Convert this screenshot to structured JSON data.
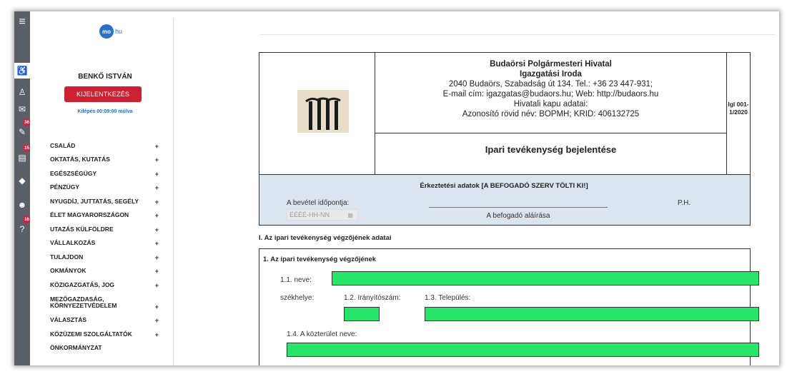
{
  "rail": {
    "icons": [
      {
        "name": "menu-icon",
        "glyph": "≡"
      },
      {
        "name": "accessibility-icon",
        "glyph": "♿"
      },
      {
        "name": "user-icon",
        "glyph": "♙"
      },
      {
        "name": "mail-icon",
        "glyph": "✉"
      },
      {
        "name": "tools-icon",
        "glyph": "✎",
        "badge": "36"
      },
      {
        "name": "card-icon",
        "glyph": "▤",
        "badge": "15"
      },
      {
        "name": "shield-icon",
        "glyph": "◆"
      },
      {
        "name": "people-icon",
        "glyph": "☻"
      },
      {
        "name": "help-icon",
        "glyph": "?",
        "badge": "16"
      }
    ]
  },
  "sidebar": {
    "logo_text": "mo",
    "logo_suffix": "hu",
    "user_name": "BENKŐ ISTVÁN",
    "logout_label": "KIJELENTKEZÉS",
    "timer": "Kilépés 00:09:00 múlva",
    "menu": [
      "CSALÁD",
      "OKTATÁS, KUTATÁS",
      "EGÉSZSÉGÜGY",
      "PÉNZÜGY",
      "NYUGDÍJ, JUTTATÁS, SEGÉLY",
      "ÉLET MAGYARORSZÁGON",
      "UTAZÁS KÜLFÖLDRE",
      "VÁLLALKOZÁS",
      "TULAJDON",
      "OKMÁNYOK",
      "KÖZIGAZGATÁS, JOG",
      "MEZŐGAZDASÁG, KÖRNYEZETVÉDELEM",
      "VÁLASZTÁS",
      "KÖZÜZEMI SZOLGÁLTATÓK",
      "ÖNKORMÁNYZAT"
    ],
    "plus": "+"
  },
  "doc": {
    "org_name": "Budaörsi Polgármesteri Hivatal",
    "org_unit": "Igazgatási Iroda",
    "address": "2040 Budaörs, Szabadság út 134. Tel.: +36 23 447-931;",
    "contact": "E-mail cím: igazgatas@budaors.hu; Web: http://budaors.hu",
    "gateway": "Hivatali kapu adatai:",
    "ids": "Azonosító rövid név: BOPMH; KRID: 406132725",
    "code_line1": "Igl 001-",
    "code_line2": "1/2020",
    "form_title": "Ipari tevékenység bejelentése",
    "arrival_title": "Érkeztetési adatok [A BEFOGADÓ SZERV TÖLTI KI!]",
    "arrival_date_label": "A bevétel időpontja:",
    "arrival_date_placeholder": "ÉÉÉÉ-HH-NN",
    "signature_label": "A befogadó aláírása",
    "ph_label": "P.H.",
    "section1_title": "I. Az ipari tevékenység végzőjének adatai",
    "box1_title": "1. Az ipari tevékenység végzőjének",
    "f_name_label": "1.1. neve:",
    "f_seat_label": "székhelye:",
    "f_zip_label": "1.2. Irányítószám:",
    "f_city_label": "1.3. Település:",
    "f_street_label": "1.4. A közterület neve:"
  },
  "colors": {
    "rail": "#5b6068",
    "logout": "#cc2033",
    "green_field": "#26e56a",
    "arrival_bg": "#dbe5f0"
  }
}
